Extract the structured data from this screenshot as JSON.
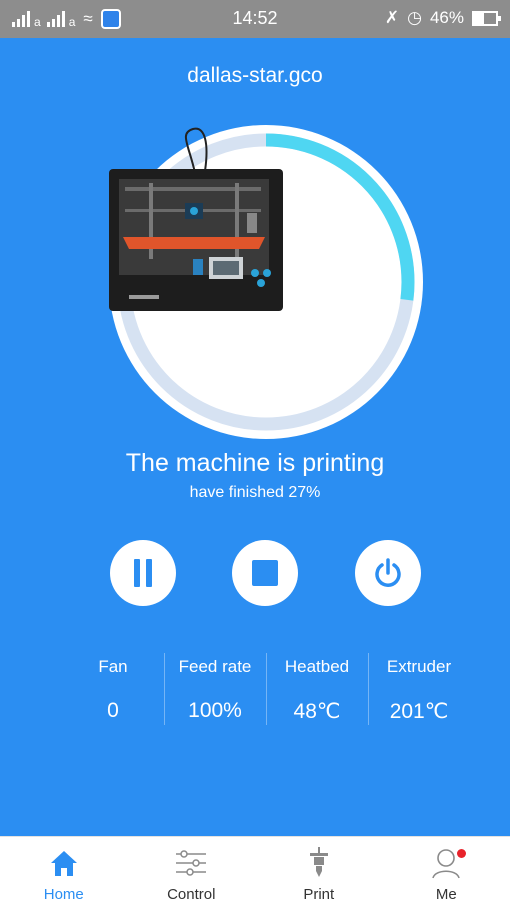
{
  "status_bar": {
    "time": "14:52",
    "battery": "46%",
    "net_letter": "a",
    "icons": [
      "signal-icon",
      "signal-icon",
      "wifi-icon",
      "app-notification-icon",
      "mute-icon",
      "alarm-icon",
      "battery-icon"
    ]
  },
  "main": {
    "file_name": "dallas-star.gco",
    "status_title": "The machine is printing",
    "status_sub": "have finished 27%",
    "progress": 0.27,
    "colors": {
      "background": "#2b8ef2",
      "ring_track": "#d6e2f2",
      "ring_progress": "#4fd6f2"
    }
  },
  "controls": {
    "pause": "pause-icon",
    "stop": "stop-icon",
    "power": "power-icon"
  },
  "stats": [
    {
      "label": "Fan",
      "value": "0"
    },
    {
      "label": "Feed rate",
      "value": "100%"
    },
    {
      "label": "Heatbed",
      "value": "48℃"
    },
    {
      "label": "Extruder",
      "value": "201℃"
    }
  ],
  "tabs": [
    {
      "label": "Home",
      "icon": "home-icon",
      "active": true
    },
    {
      "label": "Control",
      "icon": "sliders-icon",
      "active": false
    },
    {
      "label": "Print",
      "icon": "nozzle-icon",
      "active": false
    },
    {
      "label": "Me",
      "icon": "user-icon",
      "active": false,
      "badge": true
    }
  ]
}
